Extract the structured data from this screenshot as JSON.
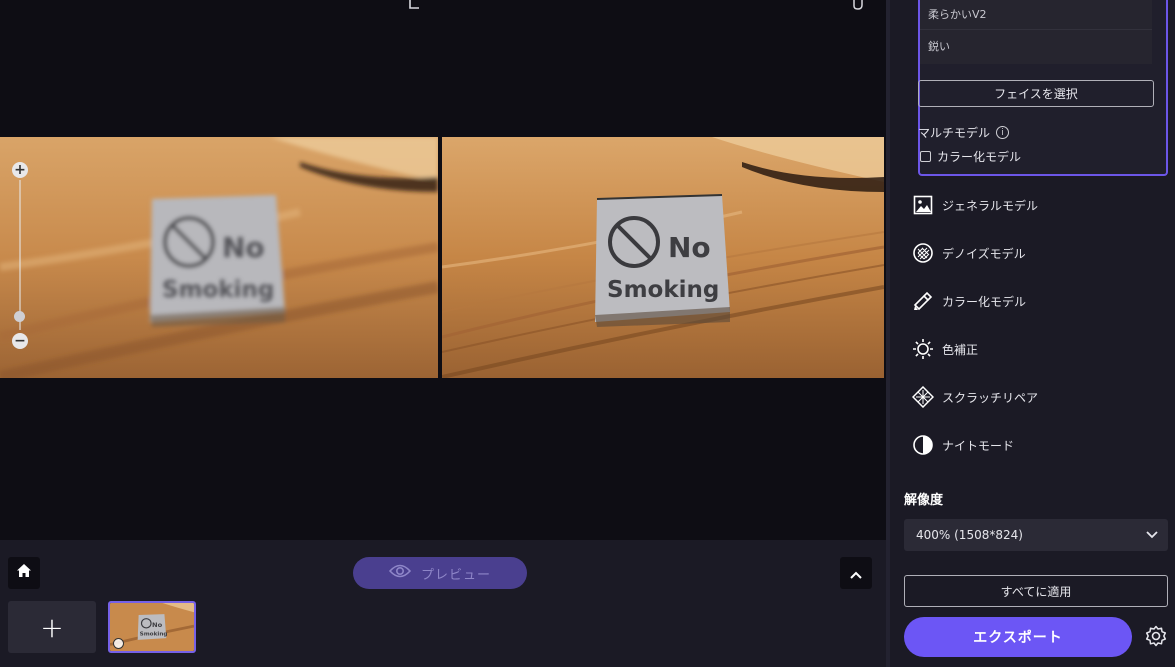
{
  "canvas": {
    "sign_text_line1": "No",
    "sign_text_line2": "Smoking"
  },
  "bottom_bar": {
    "preview_label": "プレビュー",
    "add_symbol": "+",
    "thumbnail_text_line1": "No",
    "thumbnail_text_line2": "Smoking"
  },
  "sidebar": {
    "sub_models": [
      "柔らかいV2",
      "鋭い"
    ],
    "face_button": "フェイスを選択",
    "multi_model_label": "マルチモデル",
    "info_symbol": "i",
    "colorize_checkbox_label": "カラー化モデル",
    "colorize_checked": false,
    "models": [
      {
        "label": "ジェネラルモデル",
        "icon": "image-icon"
      },
      {
        "label": "デノイズモデル",
        "icon": "denoise-icon"
      },
      {
        "label": "カラー化モデル",
        "icon": "brush-icon"
      },
      {
        "label": "色補正",
        "icon": "sun-icon"
      },
      {
        "label": "スクラッチリペア",
        "icon": "scratch-repair-icon"
      },
      {
        "label": "ナイトモード",
        "icon": "contrast-icon"
      }
    ],
    "resolution_title": "解像度",
    "resolution_value": "400% (1508*824)",
    "apply_all_button": "すべてに適用",
    "export_button": "エクスポート"
  },
  "colors": {
    "accent": "#6c56f5",
    "panel_bg": "#1b1a25",
    "canvas_bg": "#0e0d14"
  }
}
